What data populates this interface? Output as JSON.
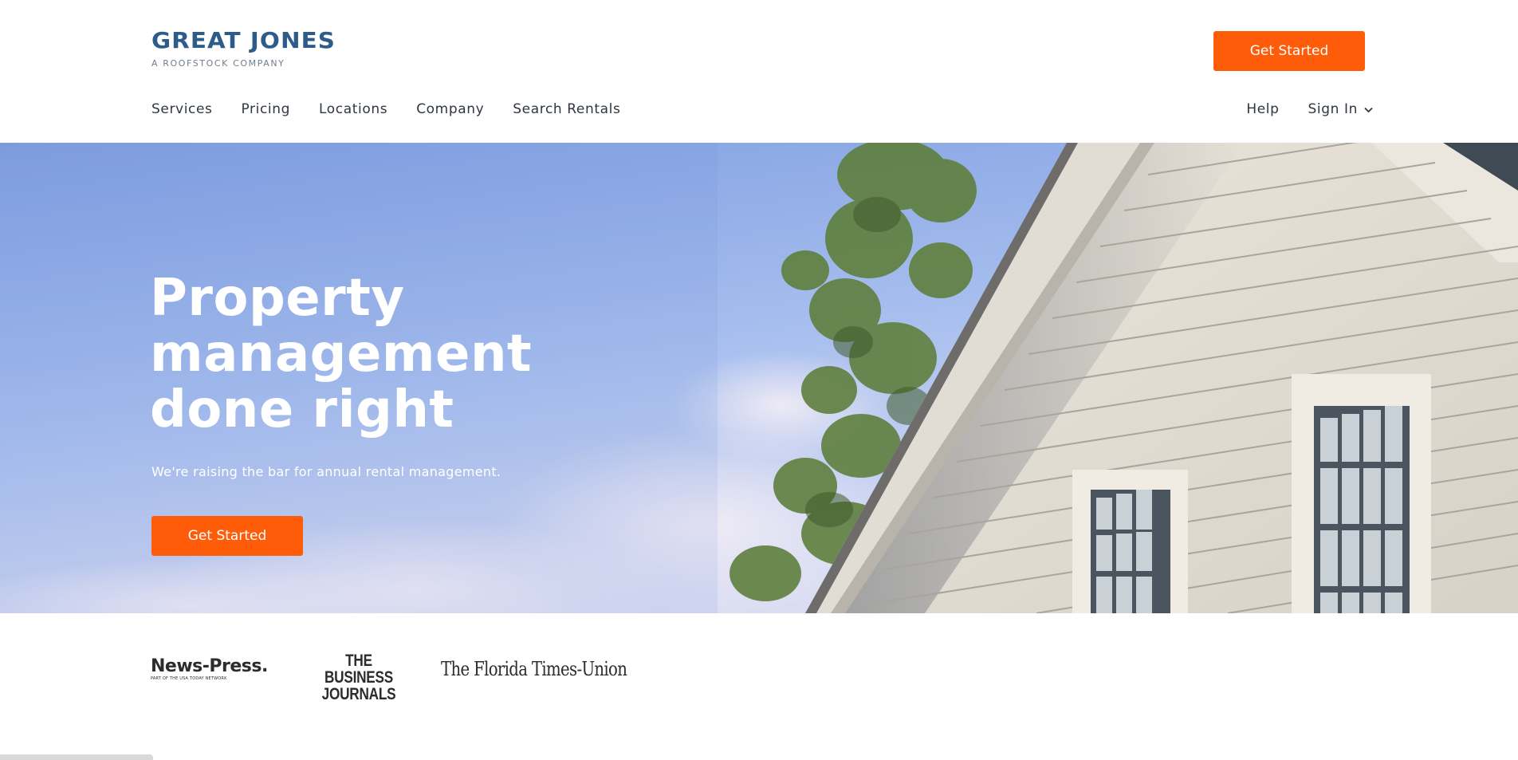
{
  "header": {
    "logo_title": "GREAT JONES",
    "logo_subtitle": "A ROOFSTOCK COMPANY",
    "cta_label": "Get Started",
    "nav_left": [
      {
        "label": "Services"
      },
      {
        "label": "Pricing"
      },
      {
        "label": "Locations"
      },
      {
        "label": "Company"
      },
      {
        "label": "Search Rentals"
      }
    ],
    "nav_right": {
      "help_label": "Help",
      "signin_label": "Sign In",
      "signin_icon": "chevron-down-icon"
    }
  },
  "hero": {
    "title_line1": "Property",
    "title_line2": "management",
    "title_line3": "done right",
    "subtitle": "We're raising the bar for annual rental management.",
    "cta_label": "Get Started",
    "image": "house-siding-sky-photo"
  },
  "press": {
    "logos": [
      {
        "name": "News-Press.",
        "tagline": "PART OF THE USA TODAY NETWORK"
      },
      {
        "name_line1": "THE BUSINESS",
        "name_line2": "JOURNALS"
      },
      {
        "name": "The Florida Times-Union"
      }
    ]
  },
  "colors": {
    "brand_blue": "#2d5b8a",
    "accent_orange": "#ff5c0a",
    "text_dark": "#2f3640"
  }
}
